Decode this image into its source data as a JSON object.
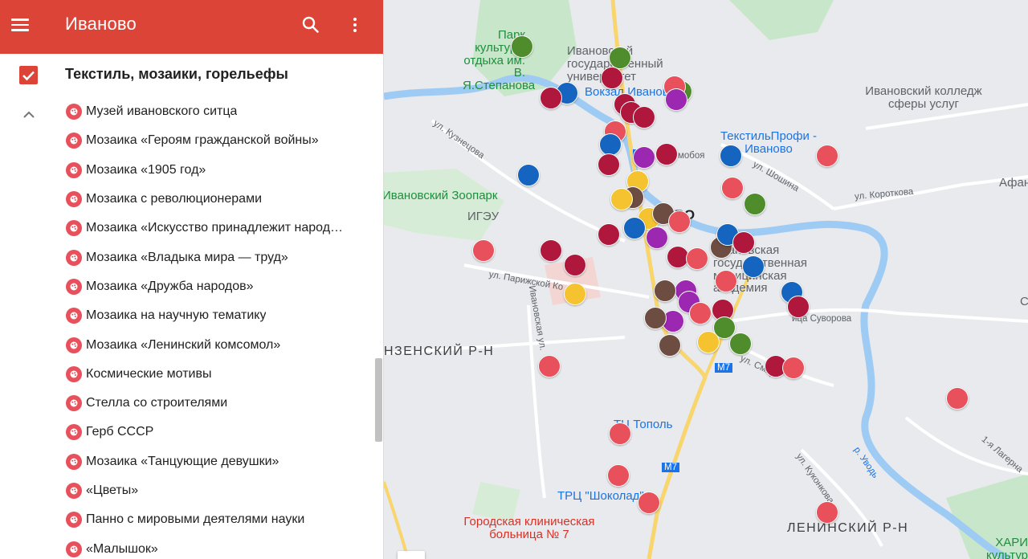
{
  "header": {
    "title": "Иваново"
  },
  "layer": {
    "title": "Текстиль, мозаики, горельефы",
    "checked": true
  },
  "items": [
    {
      "label": "Музей ивановского ситца",
      "icon": "museum-icon"
    },
    {
      "label": "Мозаика «Героям гражданской войны»",
      "icon": "palette-icon"
    },
    {
      "label": "Мозаика «1905 год»",
      "icon": "palette-icon"
    },
    {
      "label": "Мозаика с революционерами",
      "icon": "palette-icon"
    },
    {
      "label": "Мозаика «Искусство принадлежит народ…",
      "icon": "palette-icon"
    },
    {
      "label": "Мозаика «Владыка мира — труд»",
      "icon": "palette-icon"
    },
    {
      "label": "Мозаика «Дружба народов»",
      "icon": "palette-icon"
    },
    {
      "label": "Мозаика на научную тематику",
      "icon": "palette-icon"
    },
    {
      "label": "Мозаика «Ленинский комсомол»",
      "icon": "palette-icon"
    },
    {
      "label": "Космические мотивы",
      "icon": "palette-icon"
    },
    {
      "label": "Стелла со строителями",
      "icon": "monument-icon"
    },
    {
      "label": "Герб СССР",
      "icon": "palette-icon"
    },
    {
      "label": "Мозаика «Танцующие девушки»",
      "icon": "palette-icon"
    },
    {
      "label": "«Цветы»",
      "icon": "palette-icon"
    },
    {
      "label": "Панно с мировыми деятелями науки",
      "icon": "palette-icon"
    },
    {
      "label": "«Малышок»",
      "icon": "palette-icon"
    }
  ],
  "map": {
    "labels": {
      "park": "Парк культуры отдыха им. В. Я.Степанова",
      "university": "Ивановский государственный университет",
      "station": "Вокзал Иваново",
      "college": "Ивановский колледж сферы услуг",
      "textile": "ТекстильПрофи - Иваново",
      "zoo": "Ивановский Зоопарк",
      "igeu": "ИГЭУ",
      "academy": "Ивановская государственная медицинская академия",
      "city_short": "ВО",
      "district_left": "НЗЕНСКИЙ Р-Н",
      "district_right": "ЛЕНИНСКИЙ Р-Н",
      "topol": "ТЦ Тополь",
      "shokolad": "ТРЦ \"Шоколад\"",
      "hospital": "Городская клиническая больница № 7",
      "afan": "Афан",
      "khari": "ХАРИ культуры",
      "o_edge": "С"
    },
    "streets": {
      "kuznetsova": "ул. Кузнецова",
      "shoshina": "ул. Шошина",
      "korotkova": "ул. Короткова",
      "parizhskoy": "ул. Парижской Ко",
      "ivanovskaya": "Ивановская ул.",
      "suvorova": "ица Суворова",
      "smirnova": "ул. Смир",
      "kukonkova": "ул. Куконкова",
      "uvod": "р. Уводь",
      "lagernaya": "1-я Лагерна",
      "timofeya": "мобоя",
      "m7": "М7"
    }
  }
}
